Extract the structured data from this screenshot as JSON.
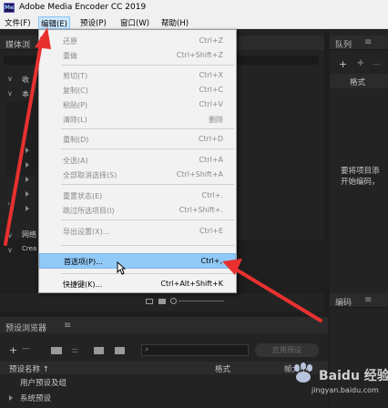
{
  "window": {
    "title": "Adobe Media Encoder CC 2019",
    "app_icon": "Me"
  },
  "menubar": {
    "items": [
      {
        "label": "文件(F)"
      },
      {
        "label": "编辑(E)",
        "active": true
      },
      {
        "label": "预设(P)"
      },
      {
        "label": "窗口(W)"
      },
      {
        "label": "帮助(H)"
      }
    ]
  },
  "edit_menu": {
    "items": [
      {
        "label": "还原",
        "shortcut": "Ctrl+Z",
        "disabled": true
      },
      {
        "label": "重做",
        "shortcut": "Ctrl+Shift+Z",
        "disabled": true
      },
      {
        "label": "剪切(T)",
        "shortcut": "Ctrl+X",
        "disabled": true
      },
      {
        "label": "复制(C)",
        "shortcut": "Ctrl+C",
        "disabled": true
      },
      {
        "label": "粘贴(P)",
        "shortcut": "Ctrl+V",
        "disabled": true
      },
      {
        "label": "清除(L)",
        "shortcut": "删除",
        "disabled": true
      },
      {
        "label": "重制(D)",
        "shortcut": "Ctrl+D",
        "disabled": true
      },
      {
        "label": "全选(A)",
        "shortcut": "Ctrl+A",
        "disabled": true
      },
      {
        "label": "全部取消选择(S)",
        "shortcut": "Ctrl+Shift+A",
        "disabled": true
      },
      {
        "label": "重置状态(E)",
        "shortcut": "Ctrl+.",
        "disabled": true
      },
      {
        "label": "跳过所选项目(I)",
        "shortcut": "Ctrl+Shift+.",
        "disabled": true
      },
      {
        "label": "导出设置(X)...",
        "shortcut": "Ctrl+E",
        "disabled": true
      },
      {
        "label": "首选项(P)...",
        "shortcut": "Ctrl+,",
        "disabled": false,
        "highlighted": true
      },
      {
        "label": "快捷键(K)...",
        "shortcut": "Ctrl+Alt+Shift+K",
        "disabled": false
      }
    ]
  },
  "media_browser": {
    "title": "媒体浏",
    "rows": [
      "收",
      "本",
      "网络",
      "Crea"
    ]
  },
  "queue": {
    "title": "队列",
    "toolbar_add": "+",
    "column_format": "格式",
    "empty_hint_line1": "要将项目添",
    "empty_hint_line2": "开始编码，"
  },
  "encoding": {
    "title": "编码"
  },
  "preset_browser": {
    "title": "预设浏览器",
    "apply_button": "应用预设",
    "columns": {
      "name": "预设名称 ↑",
      "format": "格式",
      "frame_size": "帧大小"
    },
    "rows": [
      "用户预设及组",
      "系统预设"
    ]
  },
  "watermark": {
    "text": "Baidu 经验",
    "url": "jingyan.baidu.com"
  },
  "colors": {
    "accent": "#e8312f",
    "highlight": "#91c9f7",
    "menu_bg": "#f2f2f2",
    "panel_bg": "#232323"
  }
}
